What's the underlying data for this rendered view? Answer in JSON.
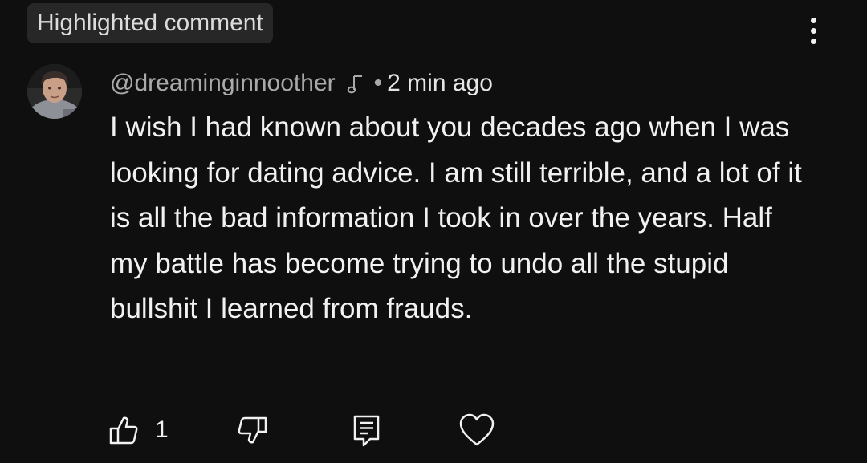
{
  "header": {
    "badge_label": "Highlighted comment",
    "menu_icon": "more-vertical-icon"
  },
  "comment": {
    "author": "@dreaminginnoother",
    "author_badge_icon": "music-note-icon",
    "separator": "•",
    "time": "2 min ago",
    "text": "I wish I had known about you decades ago when I was looking for dating advice.  I am still terrible, and a lot of it is all the bad information I took in over the years. Half my battle has become trying to undo all the stupid bullshit I learned from frauds."
  },
  "actions": {
    "like_icon": "thumbs-up-icon",
    "like_count": "1",
    "dislike_icon": "thumbs-down-icon",
    "reply_icon": "reply-icon",
    "heart_icon": "heart-icon"
  },
  "colors": {
    "background": "#0f0f0f",
    "badge_background": "#272727",
    "primary_text": "#f1f1f1",
    "secondary_text": "#aaaaaa"
  }
}
